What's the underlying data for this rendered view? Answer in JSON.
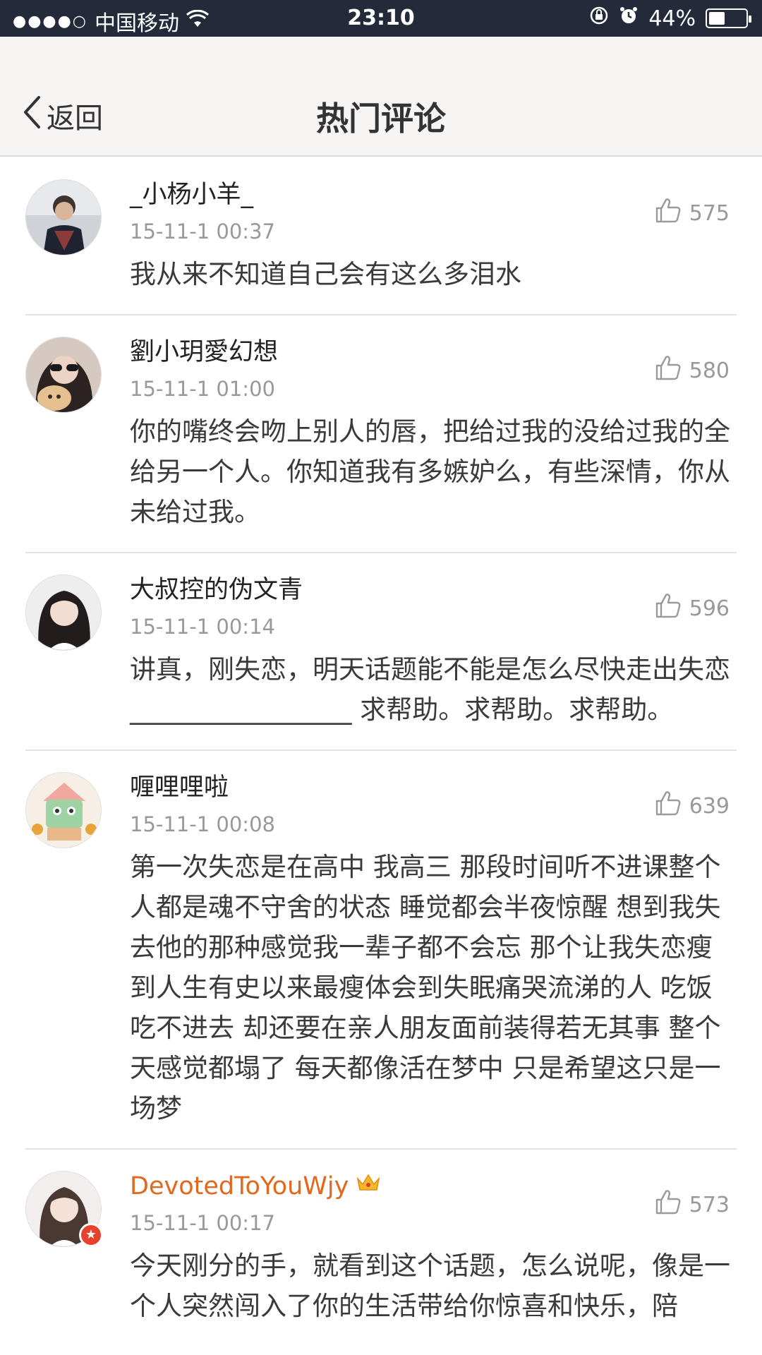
{
  "status_bar": {
    "signal": "●●●●○",
    "carrier": "中国移动",
    "time": "23:10",
    "battery_text": "44%",
    "battery_level": 0.44
  },
  "nav": {
    "back_label": "返回",
    "title": "热门评论"
  },
  "comments": [
    {
      "username": "_小杨小羊_",
      "time": "15-11-1 00:37",
      "likes": "575",
      "text": "我从来不知道自己会有这么多泪水"
    },
    {
      "username": "劉小玥愛幻想",
      "time": "15-11-1 01:00",
      "likes": "580",
      "text": "你的嘴终会吻上别人的唇，把给过我的没给过我的全给另一个人。你知道我有多嫉妒么，有些深情，你从未给过我。"
    },
    {
      "username": "大叔控的伪文青",
      "time": "15-11-1 00:14",
      "likes": "596",
      "text": "讲真，刚失恋，明天话题能不能是怎么尽快走出失恋_________________ 求帮助。求帮助。求帮助。"
    },
    {
      "username": "喱哩哩啦",
      "time": "15-11-1 00:08",
      "likes": "639",
      "text": "第一次失恋是在高中 我高三 那段时间听不进课整个人都是魂不守舍的状态 睡觉都会半夜惊醒 想到我失去他的那种感觉我一辈子都不会忘 那个让我失恋瘦到人生有史以来最瘦体会到失眠痛哭流涕的人 吃饭吃不进去 却还要在亲人朋友面前装得若无其事 整个天感觉都塌了 每天都像活在梦中 只是希望这只是一场梦"
    },
    {
      "username": "DevotedToYouWjy",
      "time": "15-11-1 00:17",
      "likes": "573",
      "text": "今天刚分的手，就看到这个话题，怎么说呢，像是一个人突然闯入了你的生活带给你惊喜和快乐，陪"
    }
  ]
}
